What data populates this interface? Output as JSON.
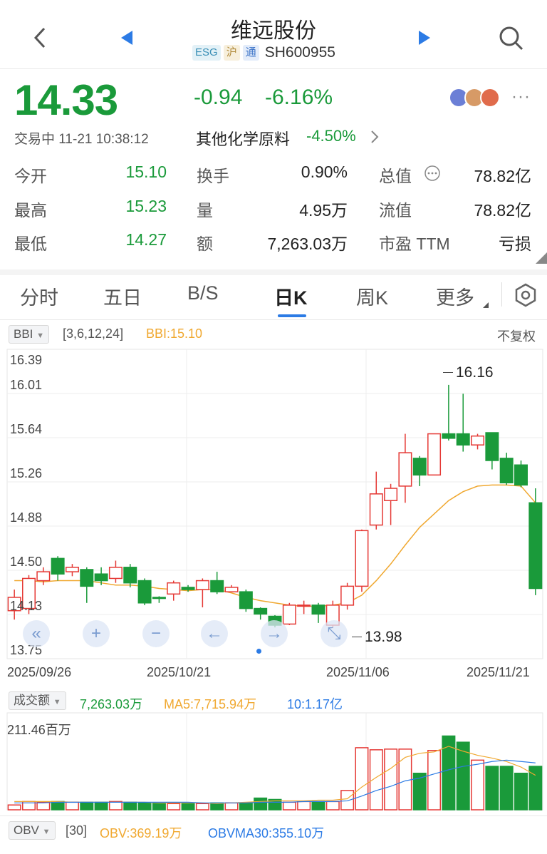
{
  "header": {
    "title": "维远股份",
    "tags": [
      "ESG",
      "沪",
      "通"
    ],
    "code": "SH600955"
  },
  "quote": {
    "price": "14.33",
    "change": "-0.94",
    "change_pct": "-6.16%",
    "status": "交易中 11-21 10:38:12",
    "industry": "其他化学原料",
    "industry_pct": "-4.50%",
    "more": "···"
  },
  "stats": [
    {
      "label": "今开",
      "value": "15.10"
    },
    {
      "label": "最高",
      "value": "15.23"
    },
    {
      "label": "最低",
      "value": "14.27"
    },
    {
      "label": "换手",
      "value": "0.90%"
    },
    {
      "label": "量",
      "value": "4.95万"
    },
    {
      "label": "额",
      "value": "7,263.03万"
    },
    {
      "label": "总值",
      "value": "78.82亿"
    },
    {
      "label": "流值",
      "value": "78.82亿"
    },
    {
      "label": "市盈 TTM",
      "value": "亏损"
    }
  ],
  "tabs": [
    "分时",
    "五日",
    "B/S",
    "日K",
    "周K",
    "更多"
  ],
  "indicator": {
    "name": "BBI",
    "params": "[3,6,12,24]",
    "value": "BBI:15.10",
    "adjust": "不复权"
  },
  "kline": {
    "y_labels": [
      "16.39",
      "16.01",
      "15.64",
      "15.26",
      "14.88",
      "14.50",
      "14.13",
      "13.75"
    ],
    "x_labels": [
      "2025/09/26",
      "2025/10/21",
      "2025/11/06",
      "2025/11/21"
    ],
    "high_mark": "16.16",
    "low_mark": "13.98"
  },
  "volume": {
    "name": "成交额",
    "value": "7,263.03万",
    "ma5": "MA5:7,715.94万",
    "ma10": "10:1.17亿",
    "y_label": "211.46百万"
  },
  "obv": {
    "name": "OBV",
    "param": "[30]",
    "value": "OBV:369.19万",
    "ma": "OBVMA30:355.10万"
  },
  "colors": {
    "up": "#e53935",
    "down": "#1a9a3a",
    "bbi": "#f0a830",
    "accent": "#2c7be5"
  },
  "chart_data": {
    "type": "candlestick",
    "ylim": [
      13.75,
      16.39
    ],
    "bars": [
      {
        "o": 14.13,
        "c": 14.25,
        "h": 14.32,
        "l": 14.05
      },
      {
        "o": 14.15,
        "c": 14.42,
        "h": 14.45,
        "l": 14.1
      },
      {
        "o": 14.4,
        "c": 14.48,
        "h": 14.52,
        "l": 14.36
      },
      {
        "o": 14.6,
        "c": 14.46,
        "h": 14.62,
        "l": 14.4
      },
      {
        "o": 14.48,
        "c": 14.52,
        "h": 14.55,
        "l": 14.44
      },
      {
        "o": 14.5,
        "c": 14.35,
        "h": 14.52,
        "l": 14.2
      },
      {
        "o": 14.46,
        "c": 14.4,
        "h": 14.52,
        "l": 14.36
      },
      {
        "o": 14.42,
        "c": 14.52,
        "h": 14.58,
        "l": 14.38
      },
      {
        "o": 14.52,
        "c": 14.38,
        "h": 14.55,
        "l": 14.34
      },
      {
        "o": 14.4,
        "c": 14.2,
        "h": 14.42,
        "l": 14.18
      },
      {
        "o": 14.25,
        "c": 14.24,
        "h": 14.26,
        "l": 14.2
      },
      {
        "o": 14.28,
        "c": 14.38,
        "h": 14.4,
        "l": 14.22
      },
      {
        "o": 14.34,
        "c": 14.32,
        "h": 14.36,
        "l": 14.3
      },
      {
        "o": 14.32,
        "c": 14.4,
        "h": 14.42,
        "l": 14.16
      },
      {
        "o": 14.4,
        "c": 14.3,
        "h": 14.48,
        "l": 14.28
      },
      {
        "o": 14.3,
        "c": 14.34,
        "h": 14.36,
        "l": 14.3
      },
      {
        "o": 14.3,
        "c": 14.15,
        "h": 14.32,
        "l": 14.12
      },
      {
        "o": 14.15,
        "c": 14.1,
        "h": 14.16,
        "l": 14.05
      },
      {
        "o": 14.08,
        "c": 14.0,
        "h": 14.09,
        "l": 13.98
      },
      {
        "o": 14.01,
        "c": 14.18,
        "h": 14.2,
        "l": 14.0
      },
      {
        "o": 14.18,
        "c": 14.18,
        "h": 14.22,
        "l": 14.1
      },
      {
        "o": 14.18,
        "c": 14.1,
        "h": 14.2,
        "l": 14.02
      },
      {
        "o": 14.0,
        "c": 14.18,
        "h": 14.22,
        "l": 13.98
      },
      {
        "o": 14.18,
        "c": 14.35,
        "h": 14.38,
        "l": 14.14
      },
      {
        "o": 14.35,
        "c": 14.85,
        "h": 14.86,
        "l": 14.3
      },
      {
        "o": 14.9,
        "c": 15.18,
        "h": 15.38,
        "l": 14.86
      },
      {
        "o": 15.12,
        "c": 15.23,
        "h": 15.27,
        "l": 14.9
      },
      {
        "o": 15.25,
        "c": 15.55,
        "h": 15.72,
        "l": 15.1
      },
      {
        "o": 15.5,
        "c": 15.35,
        "h": 15.52,
        "l": 15.25
      },
      {
        "o": 15.35,
        "c": 15.72,
        "h": 15.72,
        "l": 15.35
      },
      {
        "o": 15.72,
        "c": 15.68,
        "h": 16.16,
        "l": 15.66
      },
      {
        "o": 15.72,
        "c": 15.62,
        "h": 16.08,
        "l": 15.56
      },
      {
        "o": 15.62,
        "c": 15.7,
        "h": 15.72,
        "l": 15.58
      },
      {
        "o": 15.73,
        "c": 15.48,
        "h": 15.73,
        "l": 15.4
      },
      {
        "o": 15.5,
        "c": 15.28,
        "h": 15.55,
        "l": 15.26
      },
      {
        "o": 15.44,
        "c": 15.26,
        "h": 15.48,
        "l": 15.24
      },
      {
        "o": 15.1,
        "c": 14.33,
        "h": 15.23,
        "l": 14.27
      }
    ],
    "bbi": [
      14.4,
      14.4,
      14.39,
      14.4,
      14.4,
      14.4,
      14.38,
      14.36,
      14.36,
      14.35,
      14.33,
      14.32,
      14.31,
      14.32,
      14.32,
      14.29,
      14.25,
      14.22,
      14.2,
      14.18,
      14.17,
      14.17,
      14.18,
      14.2,
      14.27,
      14.4,
      14.55,
      14.72,
      14.88,
      15.0,
      15.12,
      15.2,
      15.25,
      15.26,
      15.26,
      15.25,
      15.1
    ],
    "volume": [
      7,
      12,
      11,
      12,
      11,
      11,
      11,
      12,
      11,
      10,
      10,
      9,
      9,
      9,
      10,
      10,
      10,
      17,
      15,
      11,
      12,
      12,
      12,
      28,
      90,
      87,
      88,
      88,
      53,
      86,
      107,
      98,
      72,
      63,
      63,
      53,
      63
    ],
    "volume_max": 211.46,
    "vol_ma5": [
      12,
      12,
      12,
      12,
      11,
      11,
      11,
      11,
      11,
      11,
      10,
      10,
      10,
      10,
      9,
      10,
      11,
      12,
      13,
      13,
      13,
      14,
      14,
      16,
      33,
      47,
      60,
      76,
      82,
      84,
      92,
      85,
      79,
      75,
      70,
      62,
      50
    ],
    "vol_ma10": [
      10,
      10,
      10,
      11,
      11,
      11,
      11,
      11,
      11,
      11,
      11,
      11,
      11,
      10,
      10,
      10,
      10,
      11,
      11,
      11,
      12,
      12,
      12,
      13,
      20,
      28,
      34,
      42,
      46,
      52,
      58,
      63,
      66,
      70,
      72,
      70,
      68
    ]
  }
}
